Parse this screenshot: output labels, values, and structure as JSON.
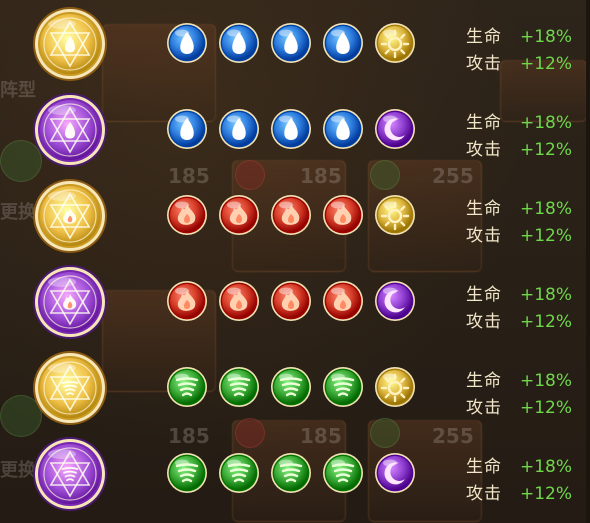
{
  "rows": [
    {
      "medal": "gold-water-emblem-icon",
      "orbs": [
        "water-orb-icon",
        "water-orb-icon",
        "water-orb-icon",
        "water-orb-icon",
        "light-orb-icon"
      ],
      "stats": [
        {
          "label": "生命",
          "value": "+18%"
        },
        {
          "label": "攻击",
          "value": "+12%"
        }
      ]
    },
    {
      "medal": "purple-water-emblem-icon",
      "orbs": [
        "water-orb-icon",
        "water-orb-icon",
        "water-orb-icon",
        "water-orb-icon",
        "dark-orb-icon"
      ],
      "stats": [
        {
          "label": "生命",
          "value": "+18%"
        },
        {
          "label": "攻击",
          "value": "+12%"
        }
      ]
    },
    {
      "medal": "gold-fire-emblem-icon",
      "orbs": [
        "fire-orb-icon",
        "fire-orb-icon",
        "fire-orb-icon",
        "fire-orb-icon",
        "light-orb-icon"
      ],
      "stats": [
        {
          "label": "生命",
          "value": "+18%"
        },
        {
          "label": "攻击",
          "value": "+12%"
        }
      ]
    },
    {
      "medal": "purple-fire-emblem-icon",
      "orbs": [
        "fire-orb-icon",
        "fire-orb-icon",
        "fire-orb-icon",
        "fire-orb-icon",
        "dark-orb-icon"
      ],
      "stats": [
        {
          "label": "生命",
          "value": "+18%"
        },
        {
          "label": "攻击",
          "value": "+12%"
        }
      ]
    },
    {
      "medal": "gold-wind-emblem-icon",
      "orbs": [
        "wind-orb-icon",
        "wind-orb-icon",
        "wind-orb-icon",
        "wind-orb-icon",
        "light-orb-icon"
      ],
      "stats": [
        {
          "label": "生命",
          "value": "+18%"
        },
        {
          "label": "攻击",
          "value": "+12%"
        }
      ]
    },
    {
      "medal": "purple-wind-emblem-icon",
      "orbs": [
        "wind-orb-icon",
        "wind-orb-icon",
        "wind-orb-icon",
        "wind-orb-icon",
        "dark-orb-icon"
      ],
      "stats": [
        {
          "label": "生命",
          "value": "+18%"
        },
        {
          "label": "攻击",
          "value": "+12%"
        }
      ]
    }
  ],
  "background": {
    "numbers": [
      "185",
      "185",
      "255",
      "185",
      "185",
      "255"
    ],
    "labels": [
      "阵型",
      "更换",
      "更换"
    ]
  },
  "colors": {
    "gold": "#f0c24a",
    "purple": "#a04fd8",
    "water": "#2f7fe0",
    "fire": "#d8402a",
    "wind": "#3fae3a",
    "stat_label": "#f3e7c9",
    "stat_value": "#6fd84a"
  }
}
